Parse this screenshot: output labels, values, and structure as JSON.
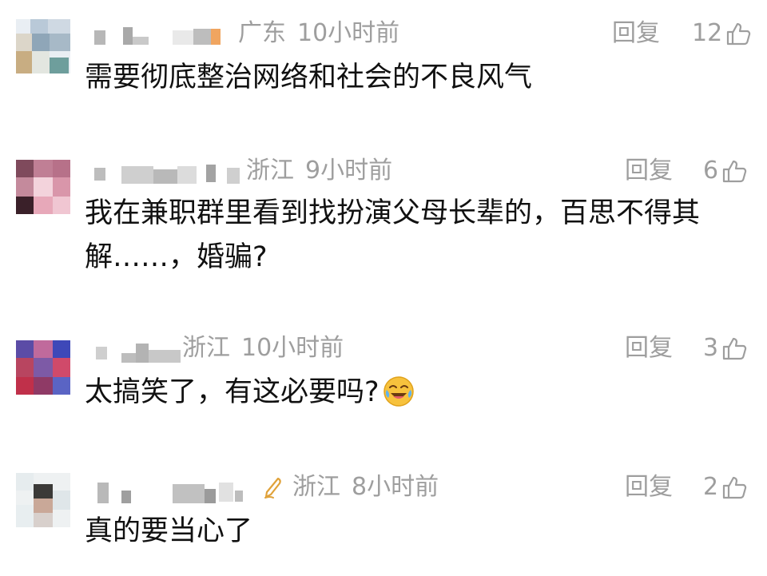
{
  "comments": [
    {
      "location": "广东",
      "time": "10小时前",
      "reply_label": "回复",
      "likes": "12",
      "text": "需要彻底整治网络和社会的不良风气"
    },
    {
      "location": "浙江",
      "time": "9小时前",
      "reply_label": "回复",
      "likes": "6",
      "text_line1": "我在兼职群里看到找扮演父母长辈的，百思不得其",
      "text_line2": "解……，婚骗?"
    },
    {
      "location": "浙江",
      "time": "10小时前",
      "reply_label": "回复",
      "likes": "3",
      "text": "太搞笑了，有这必要吗?",
      "emoji": "laughing-crying-emoji"
    },
    {
      "location": "浙江",
      "time": "8小时前",
      "reply_label": "回复",
      "likes": "2",
      "text": "真的要当心了",
      "badge_icon": "pen-badge-icon"
    }
  ],
  "colors": {
    "meta": "#9e9e9e",
    "text": "#111111",
    "background": "#ffffff"
  }
}
